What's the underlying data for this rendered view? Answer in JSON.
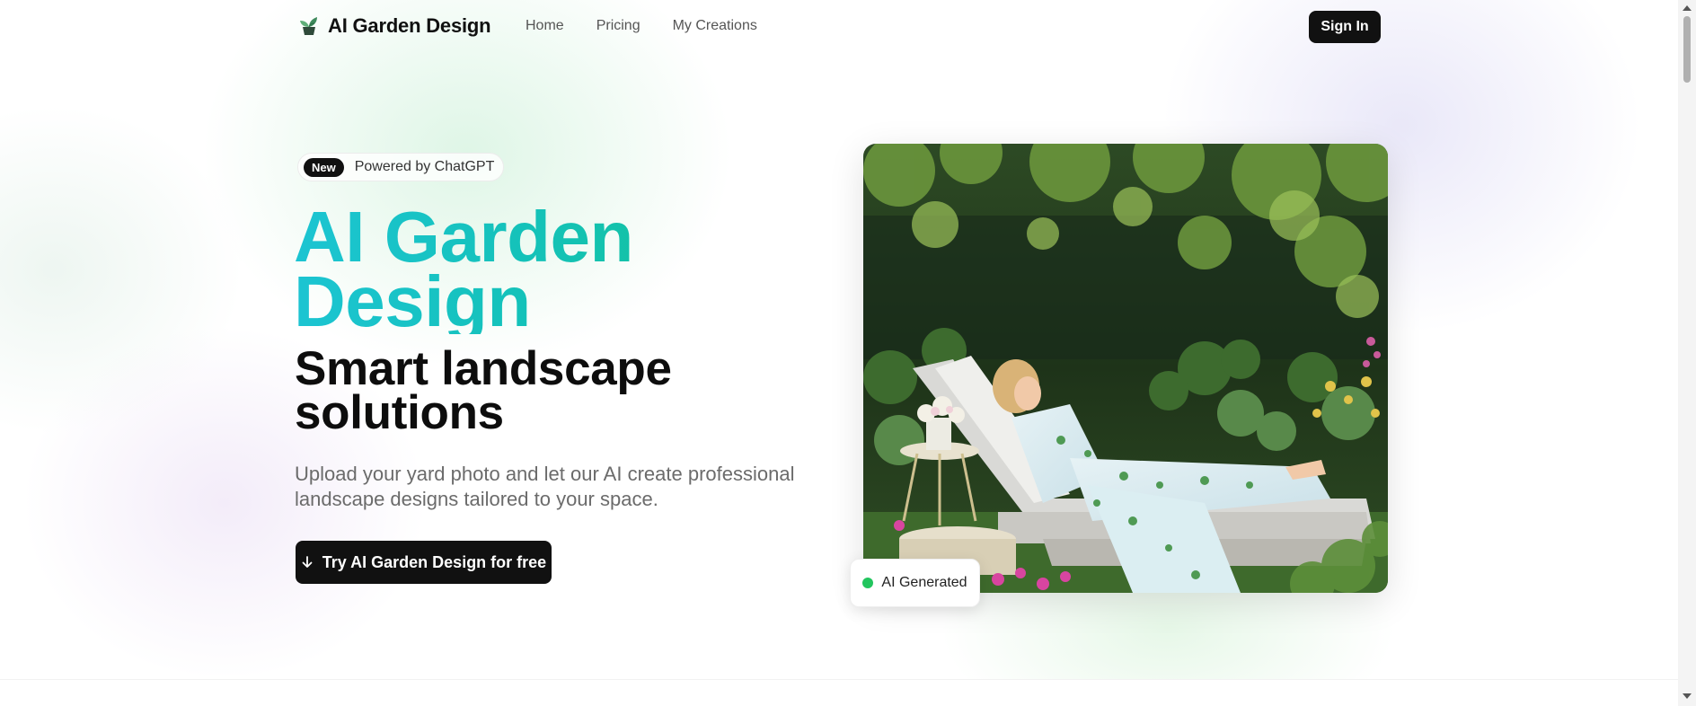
{
  "brand": {
    "name": "AI Garden Design",
    "icon": "plant-logo-icon"
  },
  "nav": {
    "links": [
      {
        "label": "Home"
      },
      {
        "label": "Pricing"
      },
      {
        "label": "My Creations"
      }
    ],
    "signin_label": "Sign In"
  },
  "hero": {
    "badge_pill": "New",
    "badge_text": "Powered by ChatGPT",
    "title": "AI Garden Design",
    "subtitle": "Smart landscape solutions",
    "description": "Upload your yard photo and let our AI create professional landscape designs tailored to your space.",
    "cta_label": "Try AI Garden Design for free",
    "cta_icon": "arrow-down-icon",
    "image_tag": "AI Generated"
  },
  "colors": {
    "accent_start": "#1cc4d2",
    "accent_end": "#12c08a",
    "button_bg": "#111111",
    "status_dot": "#22c55e"
  }
}
